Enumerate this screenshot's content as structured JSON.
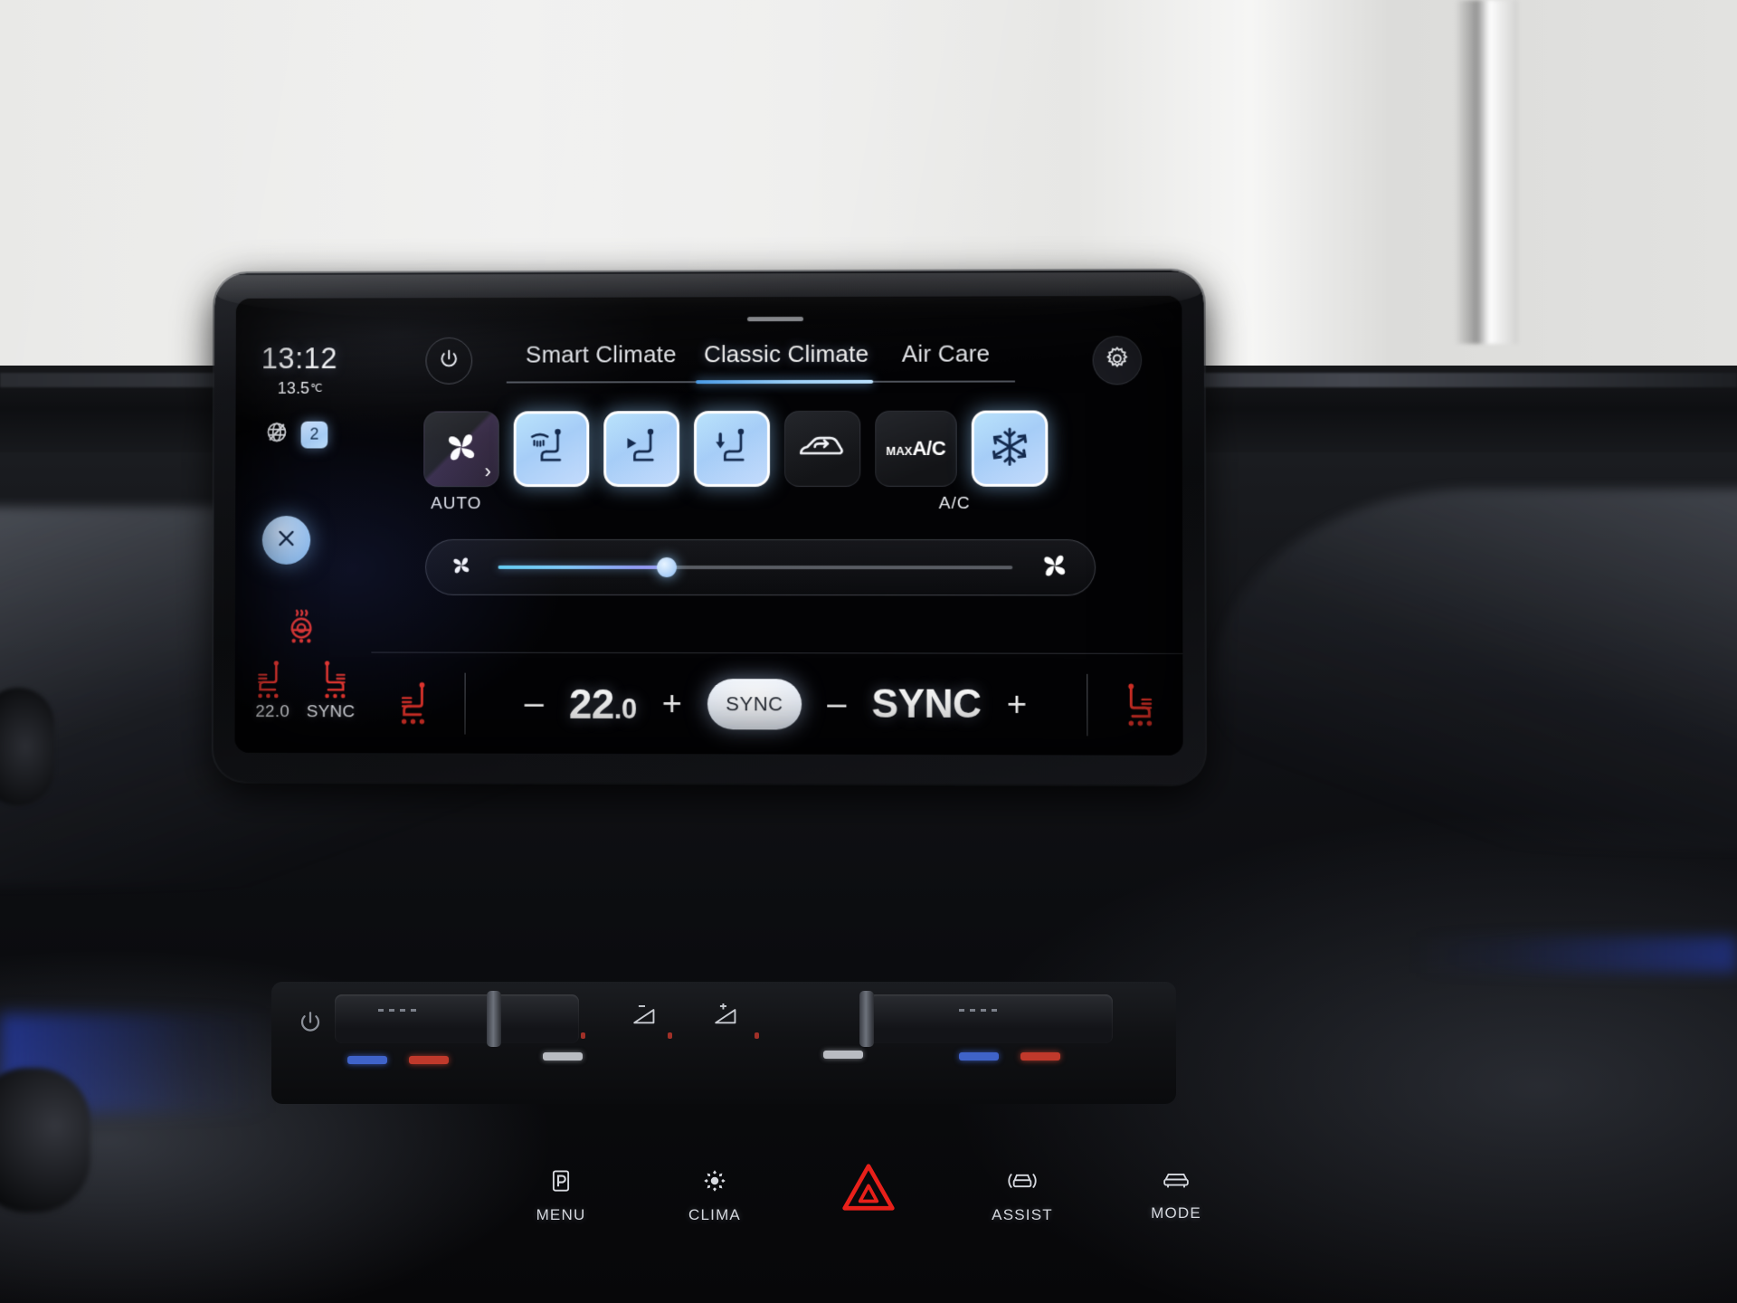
{
  "screen": {
    "status": {
      "clock": "13:12",
      "outside_temp": "13.5",
      "temp_unit": "℃",
      "no_connection_icon": "globe-slash-icon",
      "profile_badge": "2",
      "close_icon": "close-x-icon",
      "steering_wheel_heat_icon": "steering-wheel-heat-icon",
      "rail_seat_left_label": "22.0",
      "rail_seat_right_label": "SYNC"
    },
    "header": {
      "power_icon": "power-icon",
      "settings_icon": "gear-icon",
      "drag_handle": "drag-handle",
      "tabs": [
        {
          "label": "Smart Climate",
          "active": false
        },
        {
          "label": "Classic Climate",
          "active": true
        },
        {
          "label": "Air Care",
          "active": false
        }
      ]
    },
    "climate_buttons": [
      {
        "name": "auto-fan-button",
        "icon": "fan-icon",
        "label": "AUTO",
        "active": false
      },
      {
        "name": "airflow-defrost-seat-button",
        "icon": "defrost-seat-icon",
        "label": "",
        "active": true
      },
      {
        "name": "airflow-face-seat-button",
        "icon": "face-seat-icon",
        "label": "",
        "active": true
      },
      {
        "name": "airflow-foot-seat-button",
        "icon": "foot-seat-icon",
        "label": "",
        "active": true
      },
      {
        "name": "recirculation-button",
        "icon": "car-recirculate-icon",
        "label": "",
        "active": false
      },
      {
        "name": "max-ac-button",
        "icon": "text-max-ac",
        "label": "",
        "active": false,
        "text_small": "MAX",
        "text_large": "A/C"
      },
      {
        "name": "ac-button",
        "icon": "snowflake-icon",
        "label": "A/C",
        "active": true
      }
    ],
    "fan_slider": {
      "left_icon": "fan-small-icon",
      "right_icon": "fan-large-icon",
      "value_percent": 33
    },
    "bottom_bar": {
      "left_seat_icon": "seat-heat-icon",
      "right_seat_icon": "seat-heat-icon",
      "driver_minus": "–",
      "driver_temp_int": "22",
      "driver_temp_dec": ".0",
      "driver_plus": "+",
      "sync_pill_label": "SYNC",
      "passenger_minus": "–",
      "passenger_label": "SYNC",
      "passenger_plus": "+"
    }
  },
  "hardware": {
    "power_icon": "power-icon",
    "volume_down_icon": "volume-down-icon",
    "volume_up_icon": "volume-up-icon",
    "function_buttons": [
      {
        "label": "MENU",
        "icon": "parking-p-icon"
      },
      {
        "label": "CLIMA",
        "icon": "climate-fan-icon"
      },
      {
        "label": "",
        "icon": "hazard-triangle-icon"
      },
      {
        "label": "ASSIST",
        "icon": "assist-car-icon"
      },
      {
        "label": "MODE",
        "icon": "drive-mode-car-icon"
      }
    ]
  },
  "colors": {
    "accent_blue": "#a9cdf6",
    "active_tab_underline": "#9fd3fb",
    "seat_heat_red": "#e8342a",
    "hazard_red": "#e8201a"
  }
}
